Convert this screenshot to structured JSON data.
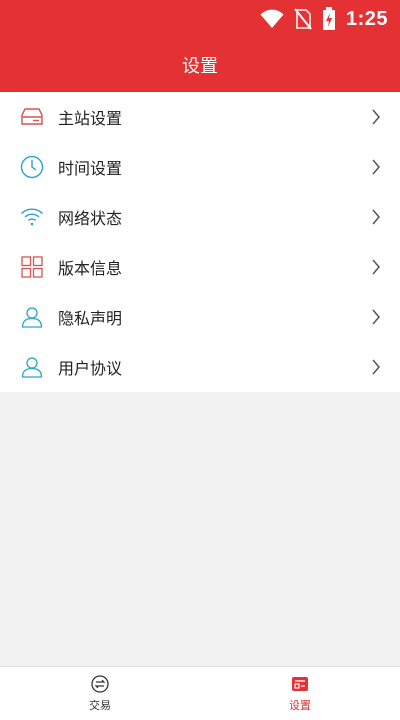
{
  "status_bar": {
    "time": "1:25",
    "icons": [
      "wifi-icon",
      "no-sim-icon",
      "battery-charging-icon"
    ]
  },
  "header": {
    "title": "设置"
  },
  "menu": {
    "items": [
      {
        "label": "主站设置",
        "icon": "server-icon",
        "icon_color": "#d9534f"
      },
      {
        "label": "时间设置",
        "icon": "clock-icon",
        "icon_color": "#2aa3c6"
      },
      {
        "label": "网络状态",
        "icon": "wifi-icon",
        "icon_color": "#2aa3c6"
      },
      {
        "label": "版本信息",
        "icon": "grid-icon",
        "icon_color": "#d9534f"
      },
      {
        "label": "隐私声明",
        "icon": "user-icon",
        "icon_color": "#2aa3c6"
      },
      {
        "label": "用户协议",
        "icon": "user-icon",
        "icon_color": "#2aa3c6"
      }
    ]
  },
  "bottom_nav": {
    "items": [
      {
        "label": "交易",
        "icon": "exchange-icon",
        "active": false
      },
      {
        "label": "设置",
        "icon": "settings-card-icon",
        "active": true
      }
    ]
  },
  "colors": {
    "brand": "#e43133",
    "background": "#f2f2f2"
  }
}
